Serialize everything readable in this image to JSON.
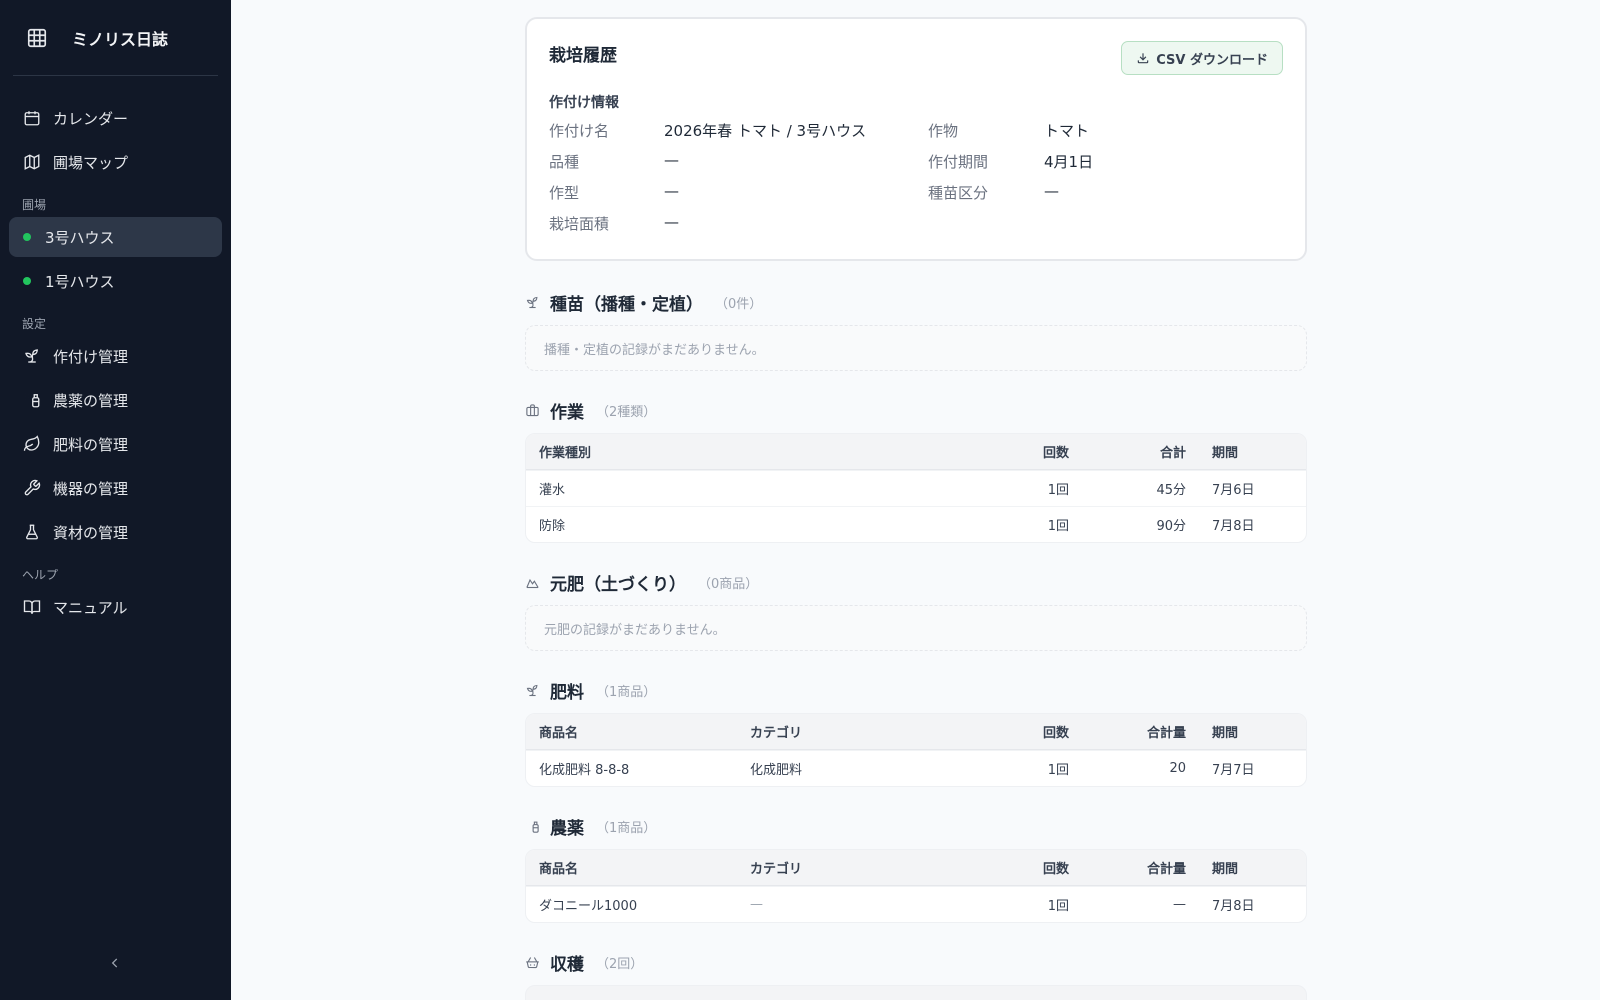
{
  "app": {
    "title": "ミノリス日誌"
  },
  "sidebar": {
    "top_items": [
      {
        "label": "カレンダー",
        "icon": "calendar-icon"
      },
      {
        "label": "圃場マップ",
        "icon": "map-icon"
      }
    ],
    "fields_label": "圃場",
    "fields": [
      {
        "label": "3号ハウス",
        "active": true
      },
      {
        "label": "1号ハウス",
        "active": false
      }
    ],
    "settings_label": "設定",
    "settings": [
      {
        "label": "作付け管理",
        "icon": "sprout-icon"
      },
      {
        "label": "農薬の管理",
        "icon": "spray-icon"
      },
      {
        "label": "肥料の管理",
        "icon": "leaf-icon"
      },
      {
        "label": "機器の管理",
        "icon": "wrench-icon"
      },
      {
        "label": "資材の管理",
        "icon": "flask-icon"
      }
    ],
    "help_label": "ヘルプ",
    "help": [
      {
        "label": "マニュアル",
        "icon": "book-icon"
      }
    ]
  },
  "history": {
    "title": "栽培履歴",
    "csv_label": "CSV ダウンロード",
    "info_title": "作付け情報",
    "info": {
      "name_k": "作付け名",
      "name_v": "2026年春 トマト / 3号ハウス",
      "crop_k": "作物",
      "crop_v": "トマト",
      "variety_k": "品種",
      "variety_v": "—",
      "period_k": "作付期間",
      "period_v": "4月1日",
      "type_k": "作型",
      "type_v": "—",
      "seed_k": "種苗区分",
      "seed_v": "—",
      "area_k": "栽培面積",
      "area_v": "—"
    }
  },
  "seedling": {
    "title": "種苗（播種・定植）",
    "count": "（0件）",
    "empty": "播種・定植の記録がまだありません。"
  },
  "work": {
    "title": "作業",
    "count": "（2種類）",
    "headers": {
      "type": "作業種別",
      "times": "回数",
      "total": "合計",
      "period": "期間"
    },
    "rows": [
      {
        "type": "灌水",
        "times": "1回",
        "total": "45分",
        "period": "7月6日"
      },
      {
        "type": "防除",
        "times": "1回",
        "total": "90分",
        "period": "7月8日"
      }
    ]
  },
  "base_fert": {
    "title": "元肥（土づくり）",
    "count": "（0商品）",
    "empty": "元肥の記録がまだありません。"
  },
  "fert": {
    "title": "肥料",
    "count": "（1商品）",
    "headers": {
      "name": "商品名",
      "category": "カテゴリ",
      "times": "回数",
      "amount": "合計量",
      "period": "期間"
    },
    "rows": [
      {
        "name": "化成肥料 8-8-8",
        "category": "化成肥料",
        "times": "1回",
        "amount": "20",
        "period": "7月7日"
      }
    ]
  },
  "pest": {
    "title": "農薬",
    "count": "（1商品）",
    "headers": {
      "name": "商品名",
      "category": "カテゴリ",
      "times": "回数",
      "amount": "合計量",
      "period": "期間"
    },
    "rows": [
      {
        "name": "ダコニール1000",
        "category": "—",
        "times": "1回",
        "amount": "—",
        "period": "7月8日"
      }
    ]
  },
  "harvest": {
    "title": "収穫",
    "count": "（2回）"
  },
  "colors": {
    "sidebar_bg": "#111827",
    "active_bg": "#2d3748",
    "dot_green": "#22c55e",
    "csv_bg": "#eef8f1"
  }
}
